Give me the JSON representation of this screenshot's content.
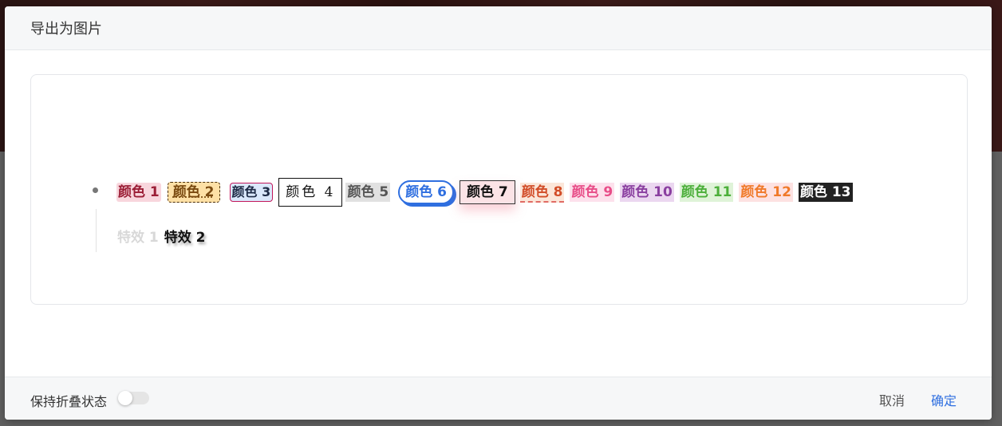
{
  "dialog": {
    "title": "导出为图片"
  },
  "preview": {
    "tags": [
      {
        "label": "颜色 1"
      },
      {
        "label": "颜色 2"
      },
      {
        "label": "颜色 3"
      },
      {
        "label": "颜色 4"
      },
      {
        "label": "颜色 5"
      },
      {
        "label": "颜色 6"
      },
      {
        "label": "颜色 7"
      },
      {
        "label": "颜色 8"
      },
      {
        "label": "颜色 9"
      },
      {
        "label": "颜色 10"
      },
      {
        "label": "颜色 11"
      },
      {
        "label": "颜色 12"
      },
      {
        "label": "颜色 13"
      }
    ],
    "effects": [
      {
        "label": "特效 1"
      },
      {
        "label": "特效 2"
      }
    ]
  },
  "footer": {
    "keep_collapsed_label": "保持折叠状态",
    "keep_collapsed_on": false,
    "cancel_label": "取消",
    "confirm_label": "确定"
  },
  "colors": {
    "accent": "#2f6fe0"
  }
}
